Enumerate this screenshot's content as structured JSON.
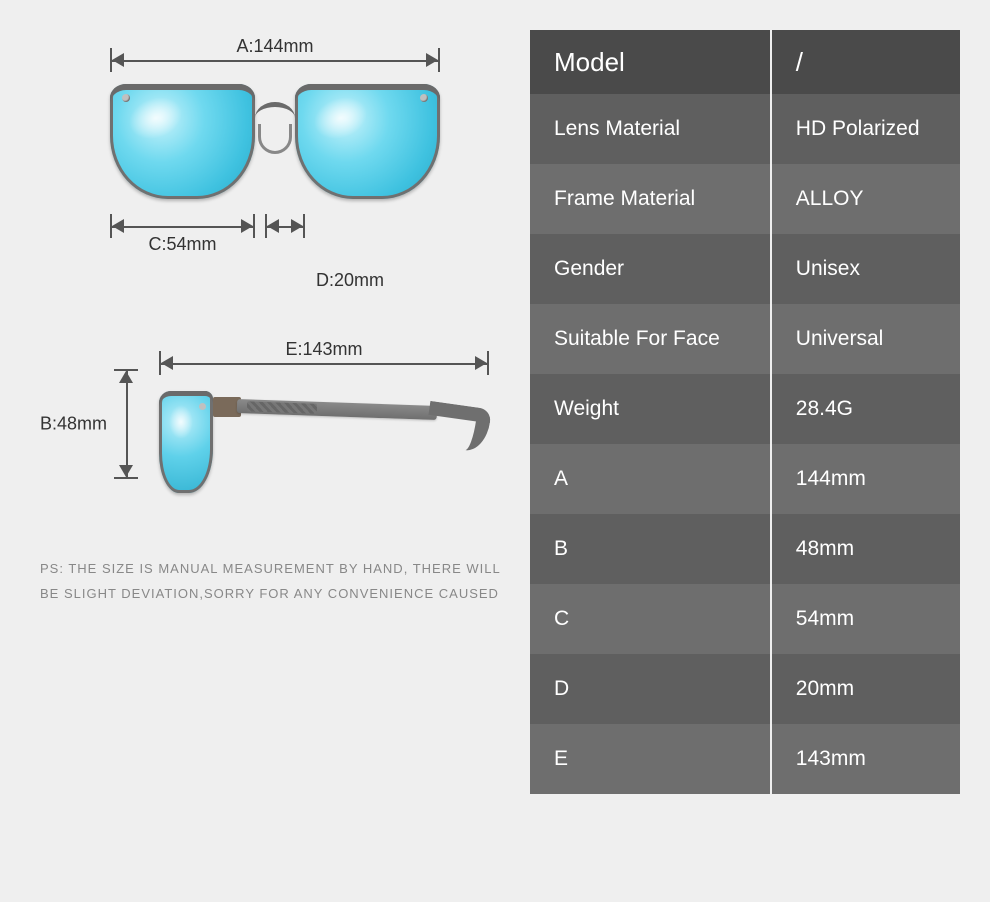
{
  "dimensions": {
    "a_label": "A:144mm",
    "b_label": "B:48mm",
    "c_label": "C:54mm",
    "d_label": "D:20mm",
    "e_label": "E:143mm"
  },
  "ps": {
    "line1": "PS: THE SIZE IS MANUAL MEASUREMENT BY HAND, THERE WILL",
    "line2": "BE SLIGHT DEVIATION,SORRY FOR ANY CONVENIENCE CAUSED"
  },
  "table": {
    "header_key": "Model",
    "header_val": "/",
    "rows": [
      {
        "k": "Lens Material",
        "v": "HD Polarized"
      },
      {
        "k": "Frame Material",
        "v": "ALLOY"
      },
      {
        "k": "Gender",
        "v": "Unisex"
      },
      {
        "k": "Suitable For Face",
        "v": "Universal"
      },
      {
        "k": "Weight",
        "v": "28.4G"
      },
      {
        "k": "A",
        "v": "144mm"
      },
      {
        "k": "B",
        "v": "48mm"
      },
      {
        "k": "C",
        "v": "54mm"
      },
      {
        "k": "D",
        "v": "20mm"
      },
      {
        "k": "E",
        "v": "143mm"
      }
    ]
  }
}
